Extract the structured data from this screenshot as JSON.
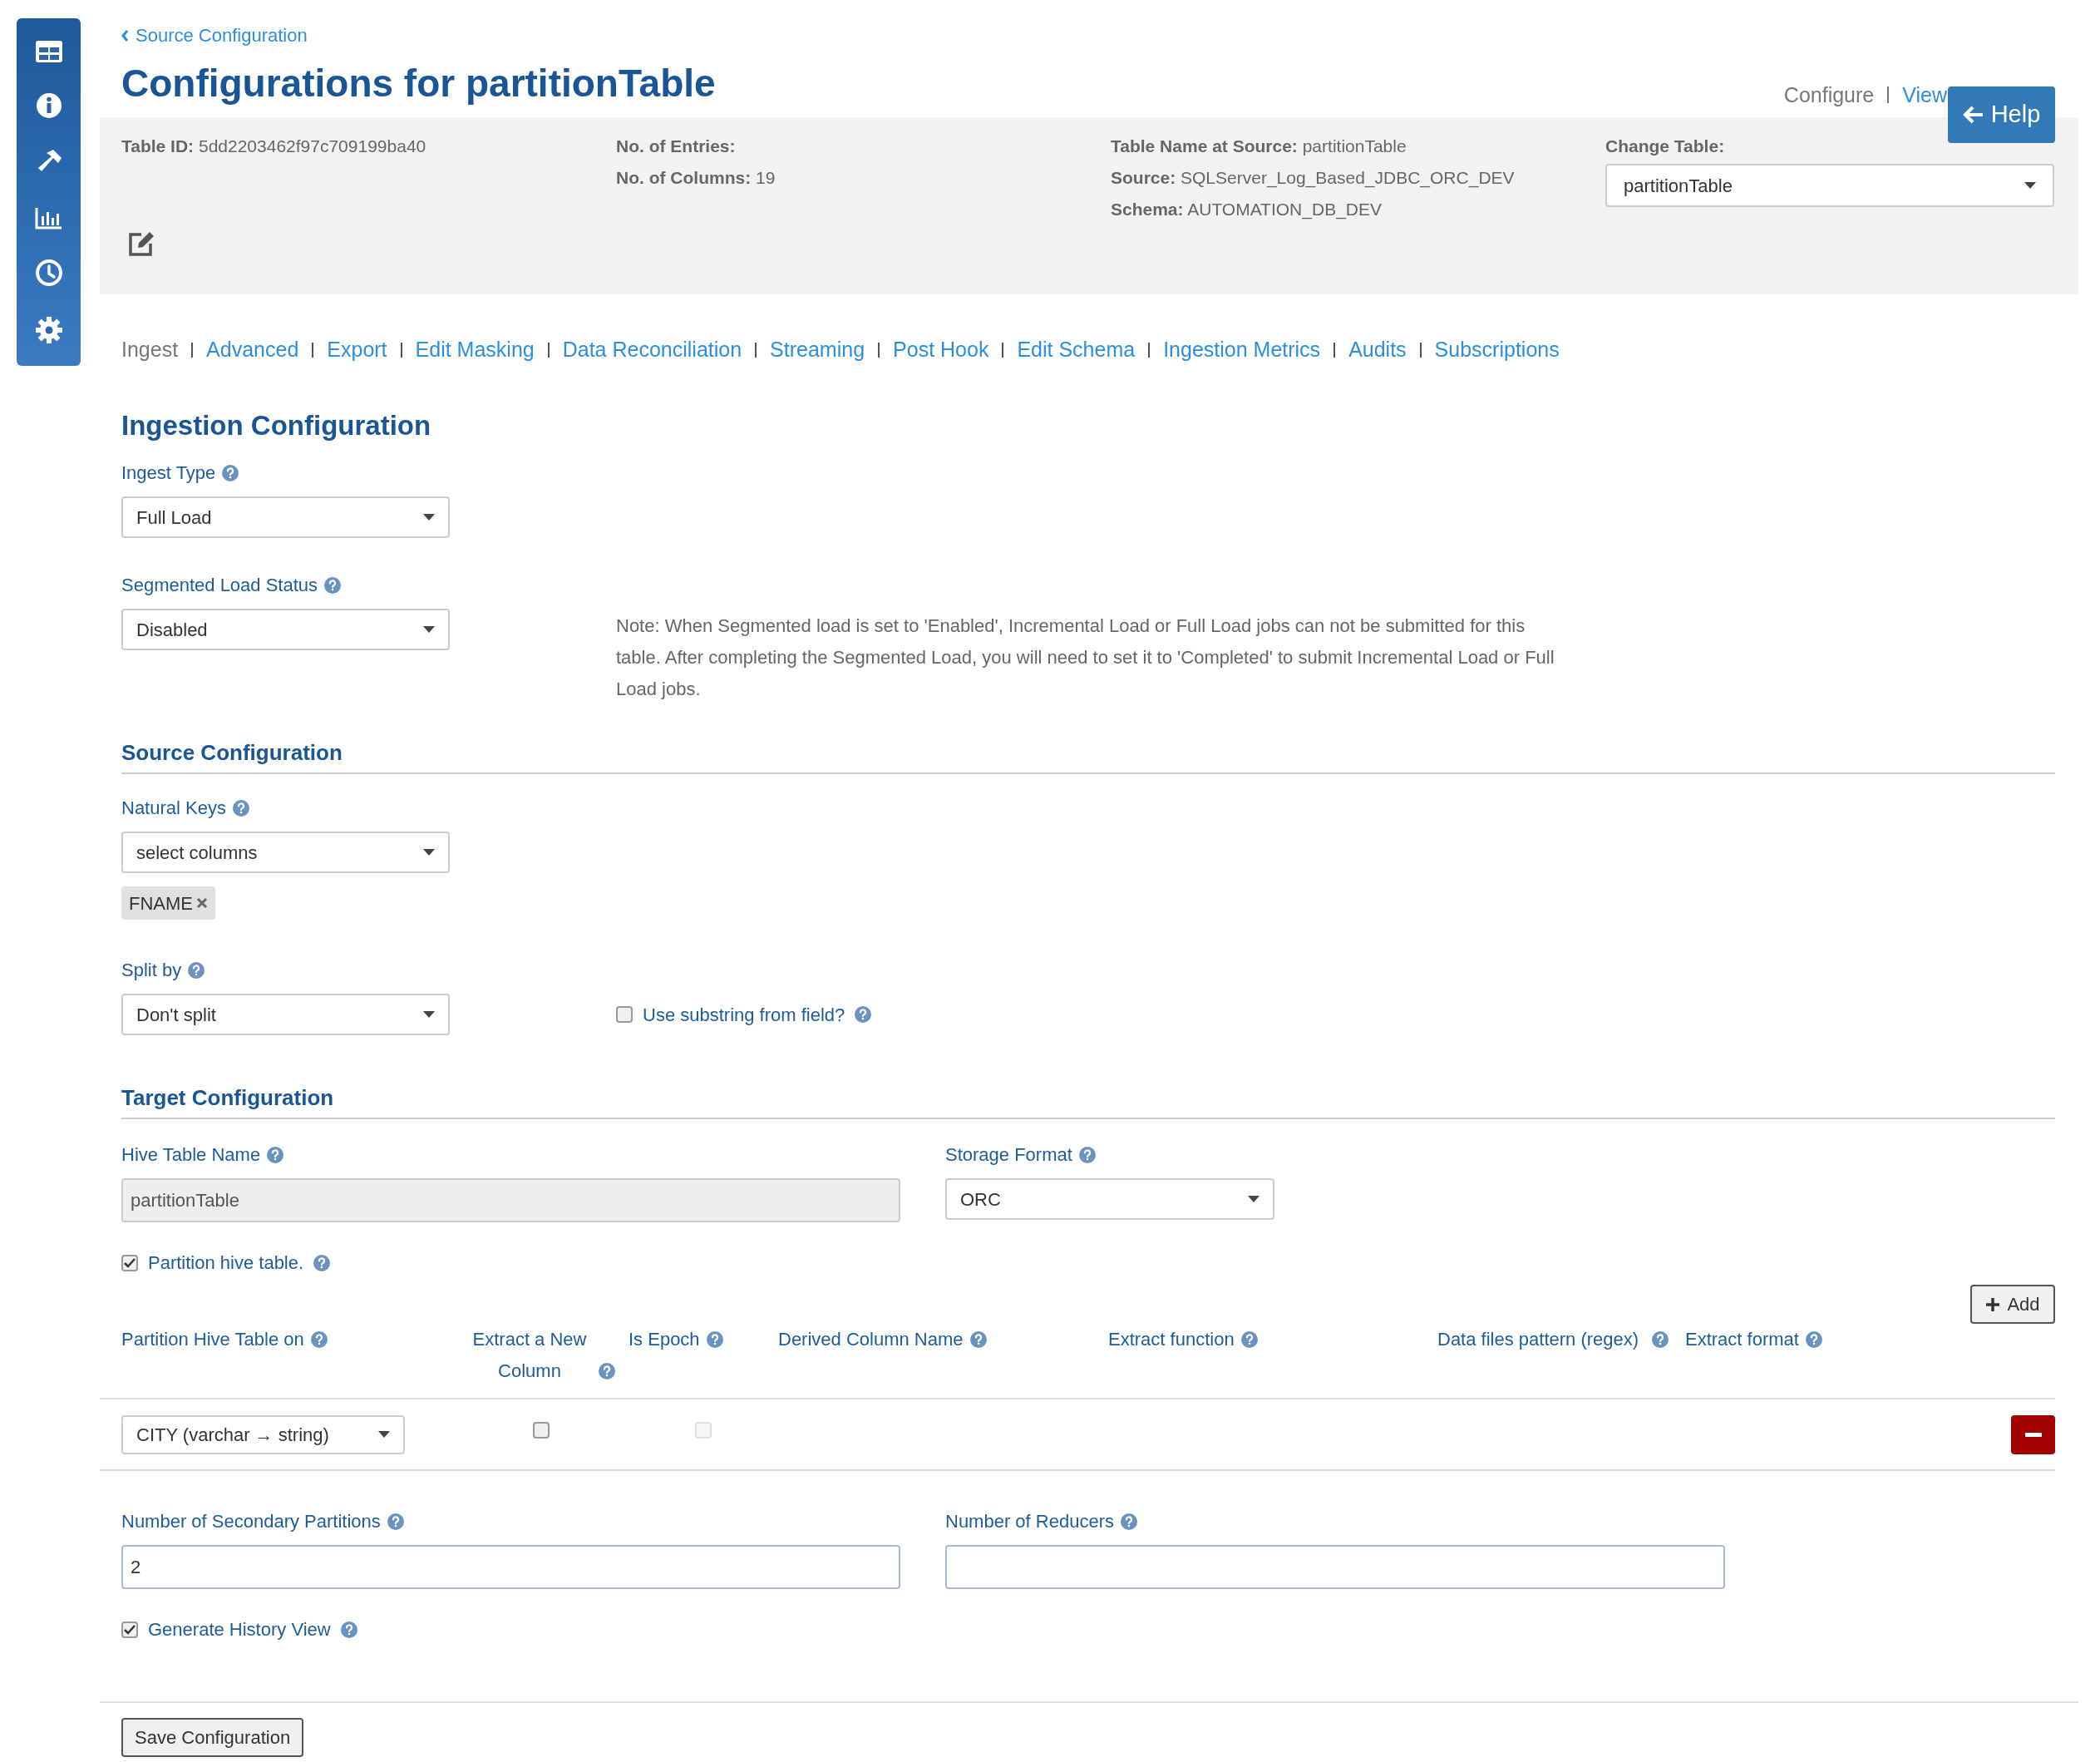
{
  "sidebar": {
    "items": [
      {
        "kind": "table"
      },
      {
        "kind": "info"
      },
      {
        "kind": "hammer"
      },
      {
        "kind": "chart"
      },
      {
        "kind": "clock"
      },
      {
        "kind": "gear"
      }
    ]
  },
  "breadcrumb": "Source Configuration",
  "title": "Configurations for partitionTable",
  "view_toggle": [
    {
      "label": "Configure",
      "selected": true
    },
    {
      "label": "View",
      "selected": false
    }
  ],
  "help_button": "Help",
  "info_panel": {
    "columns": [
      [
        {
          "label": "Table ID:",
          "value": "5dd2203462f97c709199ba40"
        }
      ],
      [
        {
          "label": "No. of Entries:"
        },
        {
          "label": "No. of Columns:",
          "value": "19"
        }
      ],
      [
        {
          "label": "Table Name at Source:",
          "value": "partitionTable"
        },
        {
          "label": "Source:",
          "value": "SQLServer_Log_Based_JDBC_ORC_DEV"
        },
        {
          "label": "Schema:",
          "value": "AUTOMATION_DB_DEV"
        }
      ]
    ],
    "change_table": {
      "label": "Change Table:",
      "value": "partitionTable"
    }
  },
  "tabs": [
    {
      "label": "Ingest",
      "selected": true
    },
    {
      "label": "Advanced",
      "selected": false
    },
    {
      "label": "Export",
      "selected": false
    },
    {
      "label": "Edit Masking",
      "selected": false
    },
    {
      "label": "Data Reconciliation",
      "selected": false
    },
    {
      "label": "Streaming",
      "selected": false
    },
    {
      "label": "Post Hook",
      "selected": false
    },
    {
      "label": "Edit Schema",
      "selected": false
    },
    {
      "label": "Ingestion Metrics",
      "selected": false
    },
    {
      "label": "Audits",
      "selected": false
    },
    {
      "label": "Subscriptions",
      "selected": false
    }
  ],
  "ingestion": {
    "heading": "Ingestion Configuration",
    "ingest_type": {
      "label": "Ingest Type",
      "value": "Full Load"
    },
    "segmented_load": {
      "label": "Segmented Load Status",
      "value": "Disabled"
    },
    "note": "Note: When Segmented load is set to 'Enabled', Incremental Load or Full Load jobs can not be submitted for this table. After completing the Segmented Load, you will need to set it to 'Completed' to submit Incremental Load or Full Load jobs."
  },
  "source": {
    "heading": "Source Configuration",
    "natural_keys": {
      "label": "Natural Keys",
      "value": "select columns",
      "tags": [
        "FNAME"
      ]
    },
    "split_by": {
      "label": "Split by",
      "value": "Don't split"
    },
    "use_substring": {
      "label": "Use substring from field?",
      "checked": false
    }
  },
  "target": {
    "heading": "Target Configuration",
    "hive_table_name": {
      "label": "Hive Table Name",
      "value": "partitionTable"
    },
    "storage_format": {
      "label": "Storage Format",
      "value": "ORC"
    },
    "partition_hive_table": {
      "label": "Partition hive table.",
      "checked": true
    },
    "add_button": "Add",
    "partition_table": {
      "columns": [
        {
          "label": "Partition Hive Table on"
        },
        {
          "label": "Extract a New Column"
        },
        {
          "label": "Is Epoch"
        },
        {
          "label": "Derived Column Name"
        },
        {
          "label": "Extract function"
        },
        {
          "label": "Data files pattern (regex)"
        },
        {
          "label": "Extract format"
        }
      ],
      "rows": [
        {
          "column": "CITY (varchar → string)",
          "extract_new": false,
          "is_epoch": false,
          "is_epoch_disabled": true
        }
      ]
    },
    "secondary_partitions": {
      "label": "Number of Secondary Partitions",
      "value": "2"
    },
    "reducers": {
      "label": "Number of Reducers"
    },
    "history_view": {
      "label": "Generate History View",
      "checked": true
    }
  },
  "save_button": "Save Configuration"
}
